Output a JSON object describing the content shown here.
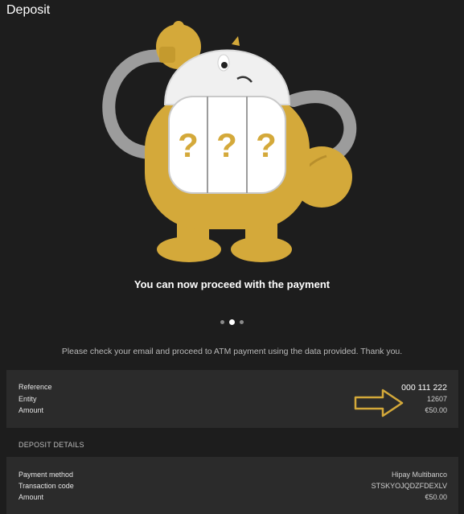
{
  "header": {
    "title": "Deposit"
  },
  "mascot": {
    "icon": "slot-machine-mascot-illustration",
    "reel_symbols": [
      "?",
      "?",
      "?"
    ]
  },
  "message": {
    "headline": "You can now proceed with the payment"
  },
  "carousel": {
    "dots": 3,
    "active_index": 1
  },
  "instructions": "Please check your email and proceed to ATM payment using the data provided. Thank you.",
  "payment_reference": {
    "rows": [
      {
        "label": "Reference",
        "value": "000 111 222"
      },
      {
        "label": "Entity",
        "value": "12607"
      },
      {
        "label": "Amount",
        "value": "€50.00"
      }
    ],
    "arrow_icon": "arrow-right-outline-icon"
  },
  "deposit_details": {
    "section_title": "DEPOSIT DETAILS",
    "rows": [
      {
        "label": "Payment method",
        "value": "Hipay Multibanco"
      },
      {
        "label": "Transaction code",
        "value": "STSKYOJQDZFDEXLV"
      },
      {
        "label": "Amount",
        "value": "€50.00"
      }
    ]
  },
  "colors": {
    "background": "#1d1d1d",
    "panel": "#2b2b2b",
    "mascot_gold": "#d4a93a",
    "arrow": "#d4a93a"
  }
}
